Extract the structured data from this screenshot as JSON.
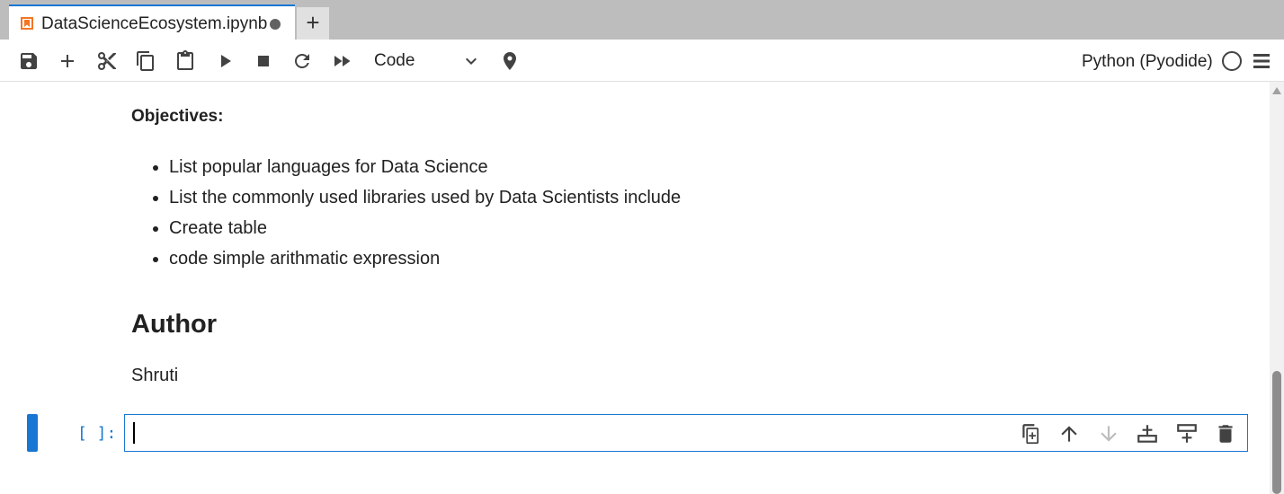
{
  "tab": {
    "title": "DataScienceEcosystem.ipynb",
    "new_tab_label": "+",
    "icon": "notebook-icon",
    "unsaved": true
  },
  "toolbar": {
    "buttons": [
      "save-icon",
      "add-cell-icon",
      "cut-icon",
      "copy-icon",
      "paste-icon",
      "run-icon",
      "stop-icon",
      "restart-icon",
      "run-all-icon"
    ],
    "cell_type": "Code",
    "kernel_name": "Python (Pyodide)",
    "kernel_status": "idle",
    "pin_icon": "pin-icon",
    "menu_icon": "menu-icon"
  },
  "notebook": {
    "objectives_heading": "Objectives:",
    "objectives": [
      "List popular languages for Data Science",
      "List the commonly used libraries used by Data Scientists include",
      "Create table",
      "code simple arithmatic expression"
    ],
    "author_heading": "Author",
    "author_name": "Shruti"
  },
  "code_cell": {
    "prompt": "[ ]:",
    "value": "",
    "tools": [
      "duplicate-cell-icon",
      "move-up-icon",
      "move-down-icon",
      "insert-below-icon",
      "insert-above-icon",
      "delete-cell-icon"
    ]
  },
  "colors": {
    "accent": "#1976d2",
    "tab_bar": "#bdbdbd",
    "icon": "#424242",
    "icon_disabled": "#bdbdbd",
    "notebook_icon": "#f37626"
  }
}
